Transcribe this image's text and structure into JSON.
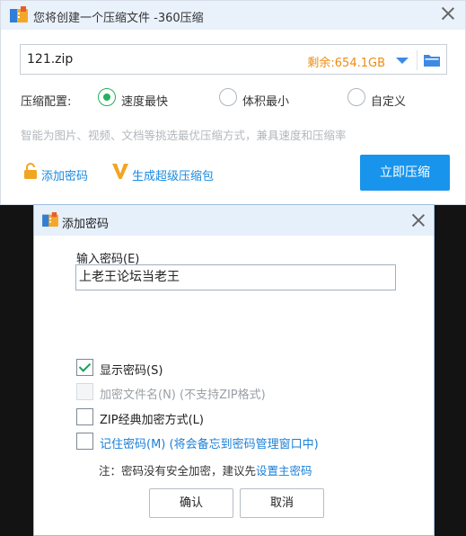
{
  "main_window": {
    "title": "您将创建一个压缩文件 -360压缩",
    "file_name": "121.zip",
    "free_space": "剩余:654.1GB",
    "config_label": "压缩配置:",
    "options": [
      {
        "label": "速度最快",
        "selected": true
      },
      {
        "label": "体积最小",
        "selected": false
      },
      {
        "label": "自定义",
        "selected": false
      }
    ],
    "hint": "智能为图片、视频、文档等挑选最优压缩方式，兼具速度和压缩率",
    "add_password_link": "添加密码",
    "super_package_link": "生成超级压缩包",
    "compress_button": "立即压缩"
  },
  "password_dialog": {
    "title": "添加密码",
    "input_label": "输入密码(E)",
    "password_value": "上老王论坛当老王",
    "checkboxes": [
      {
        "label": "显示密码(S)",
        "checked": true,
        "disabled": false
      },
      {
        "label": "加密文件名(N) (不支持ZIP格式)",
        "checked": false,
        "disabled": true
      },
      {
        "label": "ZIP经典加密方式(L)",
        "checked": false,
        "disabled": false
      },
      {
        "label": "记住密码(M) (将会备忘到密码管理窗口中)",
        "checked": false,
        "disabled": false
      }
    ],
    "note_prefix": "注：密码没有安全加密，建议先",
    "note_link": "设置主密码",
    "ok_button": "确认",
    "cancel_button": "取消"
  },
  "colors": {
    "accent_blue": "#1894ec",
    "link_blue": "#1a8be0",
    "check_green": "#26b05e",
    "free_space_orange": "#ee8b14"
  }
}
